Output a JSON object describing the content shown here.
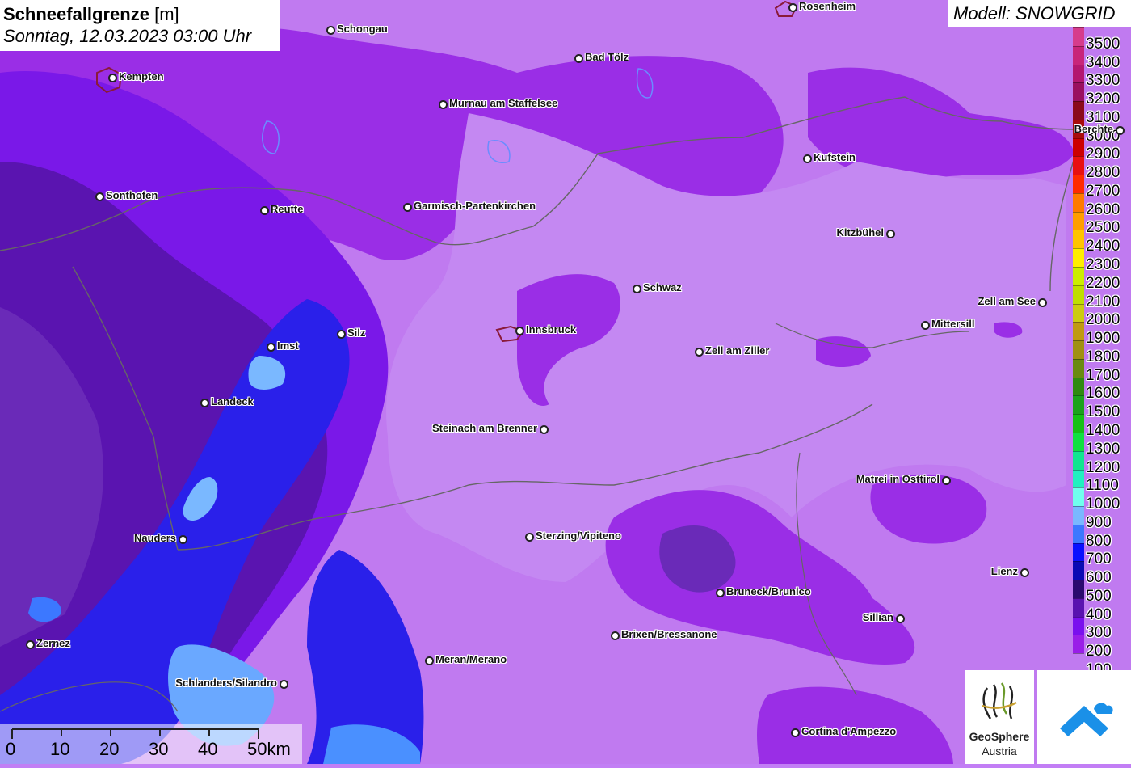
{
  "title": {
    "main": "Schneefallgrenze",
    "unit": "[m]",
    "datetime": "Sonntag, 12.03.2023 03:00 Uhr"
  },
  "model": "Modell: SNOWGRID",
  "legend": {
    "levels": [
      {
        "label": "3500",
        "color": "#d63c8c"
      },
      {
        "label": "3400",
        "color": "#c8257a"
      },
      {
        "label": "3300",
        "color": "#b31770"
      },
      {
        "label": "3200",
        "color": "#9a1060"
      },
      {
        "label": "3100",
        "color": "#8a0a1a"
      },
      {
        "label": "3000",
        "color": "#a80c0c"
      },
      {
        "label": "2900",
        "color": "#cc0000"
      },
      {
        "label": "2800",
        "color": "#e81010"
      },
      {
        "label": "2700",
        "color": "#ff2a00"
      },
      {
        "label": "2600",
        "color": "#ff7a00"
      },
      {
        "label": "2500",
        "color": "#ff9e00"
      },
      {
        "label": "2400",
        "color": "#ffc400"
      },
      {
        "label": "2300",
        "color": "#ffee00"
      },
      {
        "label": "2200",
        "color": "#ccee00"
      },
      {
        "label": "2100",
        "color": "#bfdf00"
      },
      {
        "label": "2000",
        "color": "#cccc10"
      },
      {
        "label": "1900",
        "color": "#c09a10"
      },
      {
        "label": "1800",
        "color": "#a09010"
      },
      {
        "label": "1700",
        "color": "#6a8a10"
      },
      {
        "label": "1600",
        "color": "#2f8a10"
      },
      {
        "label": "1500",
        "color": "#1ca21c"
      },
      {
        "label": "1400",
        "color": "#16c016"
      },
      {
        "label": "1300",
        "color": "#10e040"
      },
      {
        "label": "1200",
        "color": "#10e690"
      },
      {
        "label": "1100",
        "color": "#20f0c0"
      },
      {
        "label": "1000",
        "color": "#70ffee"
      },
      {
        "label": "900",
        "color": "#7ab8ff"
      },
      {
        "label": "800",
        "color": "#3c78ff"
      },
      {
        "label": "700",
        "color": "#0a10ff"
      },
      {
        "label": "600",
        "color": "#0a0ab4"
      },
      {
        "label": "500",
        "color": "#2a0a6e"
      },
      {
        "label": "400",
        "color": "#5a12b0"
      },
      {
        "label": "300",
        "color": "#7a10ee"
      },
      {
        "label": "200",
        "color": "#9a1ee8"
      },
      {
        "label": "100",
        "color": "#c07af0"
      }
    ]
  },
  "cities": [
    {
      "name": "Rosenheim",
      "side": "right"
    },
    {
      "name": "Schongau",
      "side": "right"
    },
    {
      "name": "Bad Tölz",
      "side": "right"
    },
    {
      "name": "Kempten",
      "side": "right"
    },
    {
      "name": "Murnau am Staffelsee",
      "side": "right"
    },
    {
      "name": "Berchte",
      "side": "left"
    },
    {
      "name": "Kufstein",
      "side": "right"
    },
    {
      "name": "Sonthofen",
      "side": "right"
    },
    {
      "name": "Reutte",
      "side": "right"
    },
    {
      "name": "Garmisch-Partenkirchen",
      "side": "right"
    },
    {
      "name": "Kitzbühel",
      "side": "left"
    },
    {
      "name": "Schwaz",
      "side": "right"
    },
    {
      "name": "Zell am See",
      "side": "left"
    },
    {
      "name": "Mittersill",
      "side": "right"
    },
    {
      "name": "Silz",
      "side": "right"
    },
    {
      "name": "Innsbruck",
      "side": "right"
    },
    {
      "name": "Imst",
      "side": "right"
    },
    {
      "name": "Zell am Ziller",
      "side": "right"
    },
    {
      "name": "Landeck",
      "side": "right"
    },
    {
      "name": "Steinach am Brenner",
      "side": "left"
    },
    {
      "name": "Matrei in Osttirol",
      "side": "left"
    },
    {
      "name": "Nauders",
      "side": "left"
    },
    {
      "name": "Sterzing/Vipiteno",
      "side": "right"
    },
    {
      "name": "Lienz",
      "side": "left"
    },
    {
      "name": "Bruneck/Brunico",
      "side": "right"
    },
    {
      "name": "Sillian",
      "side": "left"
    },
    {
      "name": "Brixen/Bressanone",
      "side": "right"
    },
    {
      "name": "Zernez",
      "side": "right"
    },
    {
      "name": "Meran/Merano",
      "side": "right"
    },
    {
      "name": "Schlanders/Silandro",
      "side": "left"
    },
    {
      "name": "Cortina d'Ampezzo",
      "side": "right"
    }
  ],
  "scale_bar": {
    "labels": [
      "0",
      "10",
      "20",
      "30",
      "40",
      "50km"
    ]
  },
  "logos": {
    "geosphere_line1": "GeoSphere",
    "geosphere_line2": "Austria"
  }
}
